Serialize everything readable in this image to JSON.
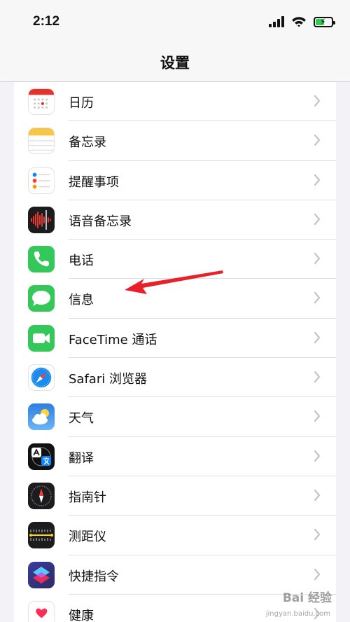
{
  "status_bar": {
    "time": "2:12",
    "battery_level": 0.55,
    "battery_color": "#34c759"
  },
  "nav": {
    "title": "设置"
  },
  "settings": [
    {
      "label": "日历",
      "icon": "calendar-icon"
    },
    {
      "label": "备忘录",
      "icon": "notes-icon"
    },
    {
      "label": "提醒事项",
      "icon": "reminders-icon"
    },
    {
      "label": "语音备忘录",
      "icon": "voice-memos-icon"
    },
    {
      "label": "电话",
      "icon": "phone-icon"
    },
    {
      "label": "信息",
      "icon": "messages-icon"
    },
    {
      "label": "FaceTime 通话",
      "icon": "facetime-icon"
    },
    {
      "label": "Safari 浏览器",
      "icon": "safari-icon"
    },
    {
      "label": "天气",
      "icon": "weather-icon"
    },
    {
      "label": "翻译",
      "icon": "translate-icon"
    },
    {
      "label": "指南针",
      "icon": "compass-icon"
    },
    {
      "label": "测距仪",
      "icon": "measure-icon"
    },
    {
      "label": "快捷指令",
      "icon": "shortcuts-icon"
    },
    {
      "label": "健康",
      "icon": "health-icon"
    }
  ],
  "annotation": {
    "arrow_color": "#e8202a"
  },
  "watermark": {
    "text": "Bai 经验",
    "sub": "jingyan.baidu.com"
  }
}
